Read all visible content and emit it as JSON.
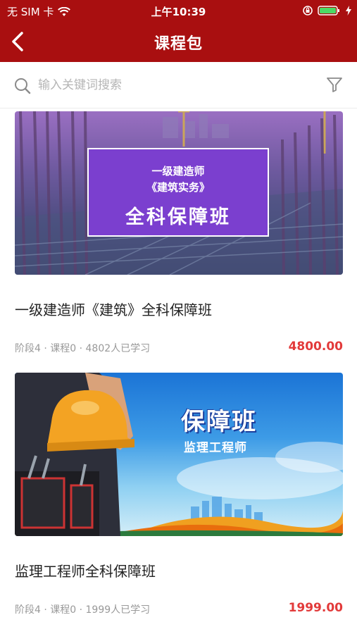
{
  "status_bar": {
    "carrier": "无 SIM 卡",
    "time": "上午10:39"
  },
  "nav": {
    "title": "课程包",
    "back_icon": "chevron-left-icon"
  },
  "search": {
    "placeholder": "输入关键词搜索",
    "value": "",
    "search_icon": "search-icon",
    "filter_icon": "filter-icon"
  },
  "courses": [
    {
      "title": "一级建造师《建筑》全科保障班",
      "meta": "阶段4 · 课程0 · 4802人已学习",
      "price": "4800.00",
      "cover": {
        "line1": "一级建造师",
        "line2": "《建筑实务》",
        "line3": "全科保障班"
      }
    },
    {
      "title": "监理工程师全科保障班",
      "meta": "阶段4 · 课程0 · 1999人已学习",
      "price": "1999.00",
      "cover": {
        "line1": "保障班",
        "line2": "监理工程师"
      }
    }
  ],
  "colors": {
    "brand": "#a90f10",
    "price": "#e23a3a",
    "meta": "#999999"
  }
}
